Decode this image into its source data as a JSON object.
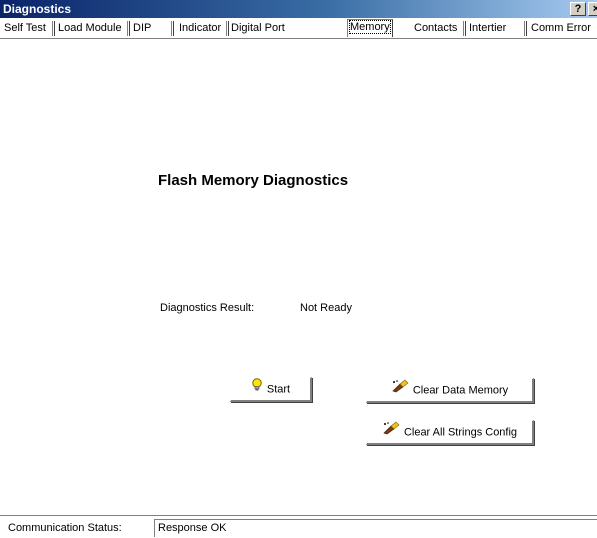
{
  "window": {
    "title": "Diagnostics",
    "help_label": "?",
    "close_label": "×"
  },
  "tabs": [
    {
      "label": "Self Test"
    },
    {
      "label": "Load Module"
    },
    {
      "label": "DIP"
    },
    {
      "label": "Indicator"
    },
    {
      "label": "Digital Port"
    },
    {
      "label": "Memory",
      "active": true
    },
    {
      "label": "Contacts"
    },
    {
      "label": "Intertier"
    },
    {
      "label": "Comm Error"
    }
  ],
  "main": {
    "heading": "Flash Memory Diagnostics",
    "result_label": "Diagnostics Result:",
    "result_value": "Not Ready"
  },
  "buttons": {
    "start": {
      "label": "Start",
      "icon": "lightbulb-icon"
    },
    "clear_data_memory": {
      "label": "Clear Data Memory",
      "icon": "eraser-icon"
    },
    "clear_all_strings": {
      "label": "Clear All Strings Config",
      "icon": "eraser-icon"
    }
  },
  "status": {
    "label": "Communication Status:",
    "value": "Response OK"
  }
}
